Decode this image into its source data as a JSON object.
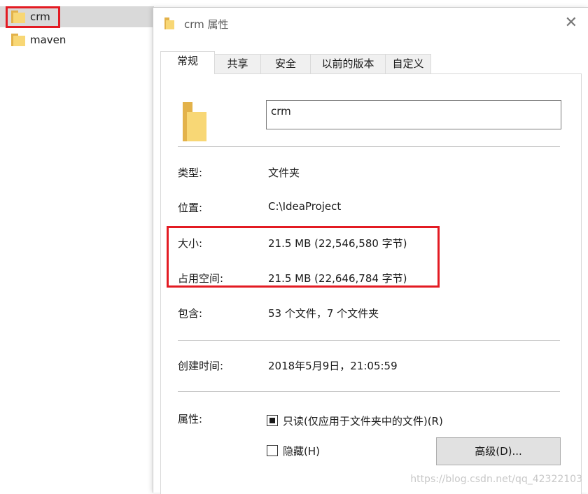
{
  "explorer": {
    "items": [
      {
        "name": "crm",
        "selected": true
      },
      {
        "name": "maven",
        "selected": false
      }
    ]
  },
  "dialog": {
    "title": "crm 属性",
    "close_glyph": "✕",
    "tabs": [
      "常规",
      "共享",
      "安全",
      "以前的版本",
      "自定义"
    ],
    "active_tab": "常规",
    "folder_name": "crm",
    "fields": {
      "type_label": "类型:",
      "type_value": "文件夹",
      "location_label": "位置:",
      "location_value": "C:\\IdeaProject",
      "size_label": "大小:",
      "size_value": "21.5 MB (22,546,580 字节)",
      "disk_label": "占用空间:",
      "disk_value": "21.5 MB (22,646,784 字节)",
      "contains_label": "包含:",
      "contains_value": "53 个文件，7 个文件夹",
      "created_label": "创建时间:",
      "created_value": "2018年5月9日，21:05:59",
      "attributes_label": "属性:"
    },
    "readonly_label": "只读(仅应用于文件夹中的文件)(R)",
    "readonly_state": "checked",
    "hidden_label": "隐藏(H)",
    "hidden_state": "unchecked",
    "advanced_button": "高级(D)..."
  },
  "watermark": "https://blog.csdn.net/qq_42322103",
  "colors": {
    "highlight_border": "#e31b23",
    "folder_yellow": "#f8d775",
    "selected_row": "#d9d9d9"
  }
}
